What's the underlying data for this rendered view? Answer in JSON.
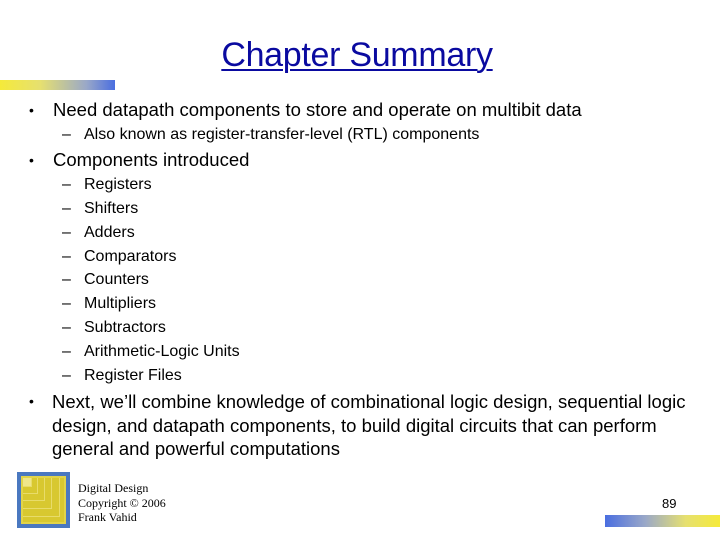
{
  "slide": {
    "title": "Chapter Summary",
    "bullets": [
      {
        "text": "Need datapath components to store and operate on multibit data",
        "subitems": [
          "Also known as register-transfer-level (RTL) components"
        ]
      },
      {
        "text": "Components introduced",
        "subitems": [
          "Registers",
          "Shifters",
          "Adders",
          "Comparators",
          "Counters",
          "Multipliers",
          "Subtractors",
          "Arithmetic-Logic Units",
          "Register Files"
        ]
      },
      {
        "text": "Next, we’ll combine knowledge of combinational logic design, sequential logic design, and datapath components, to build digital circuits that can perform general and powerful computations"
      }
    ],
    "bullet_glyph": "•",
    "dash_glyph": "–"
  },
  "footer": {
    "logo_icon": "nested-squares-logo",
    "lines": [
      "Digital Design",
      "Copyright © 2006",
      "Frank Vahid"
    ],
    "page_number": "89"
  },
  "colors": {
    "title": "#0a0aa0",
    "accent_yellow": "#f5ea3a",
    "accent_blue": "#4a6ee0"
  }
}
